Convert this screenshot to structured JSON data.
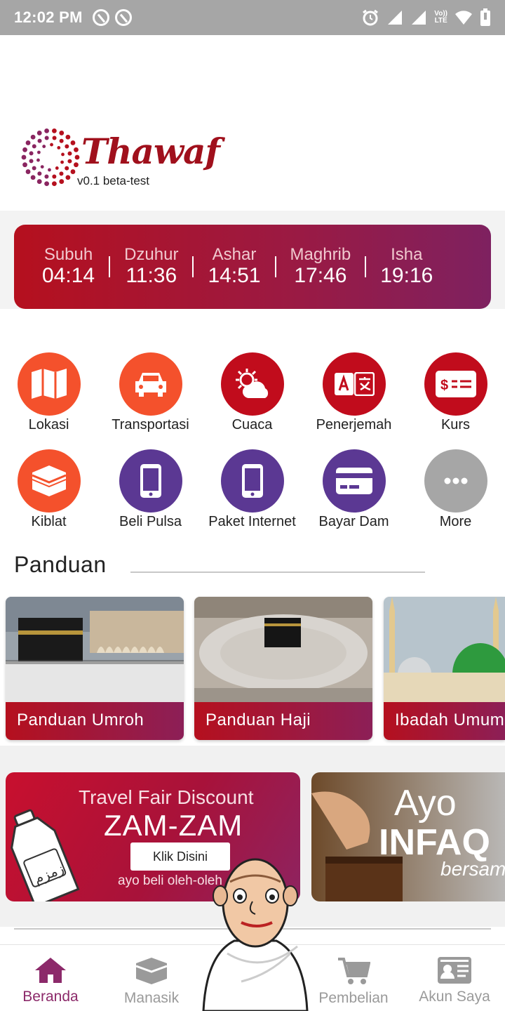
{
  "status_bar": {
    "time": "12:02 PM",
    "lte_top": "Vo))",
    "lte_bottom": "LTE"
  },
  "header": {
    "app_name": "Thawaf",
    "version": "v0.1 beta-test"
  },
  "prayer_times": [
    {
      "name": "Subuh",
      "time": "04:14"
    },
    {
      "name": "Dzuhur",
      "time": "11:36"
    },
    {
      "name": "Ashar",
      "time": "14:51"
    },
    {
      "name": "Maghrib",
      "time": "17:46"
    },
    {
      "name": "Isha",
      "time": "19:16"
    }
  ],
  "menu": [
    {
      "label": "Lokasi",
      "icon": "map-icon",
      "color": "#f4512c"
    },
    {
      "label": "Transportasi",
      "icon": "car-icon",
      "color": "#f4512c"
    },
    {
      "label": "Cuaca",
      "icon": "weather-icon",
      "color": "#c10c1c"
    },
    {
      "label": "Penerjemah",
      "icon": "translate-icon",
      "color": "#c10c1c"
    },
    {
      "label": "Kurs",
      "icon": "currency-icon",
      "color": "#c10c1c"
    },
    {
      "label": "Kiblat",
      "icon": "kaaba-icon",
      "color": "#f4512c"
    },
    {
      "label": "Beli Pulsa",
      "icon": "phone-icon",
      "color": "#5b3893"
    },
    {
      "label": "Paket Internet",
      "icon": "phone-icon",
      "color": "#5b3893"
    },
    {
      "label": "Bayar Dam",
      "icon": "card-icon",
      "color": "#5b3893"
    },
    {
      "label": "More",
      "icon": "more-icon",
      "color": "#a6a6a6"
    }
  ],
  "guide": {
    "title": "Panduan",
    "cards": [
      {
        "label": "Panduan Umroh"
      },
      {
        "label": "Panduan Haji"
      },
      {
        "label": "Ibadah Umum"
      }
    ]
  },
  "promos": {
    "zamzam": {
      "line1": "Travel Fair Discount",
      "line2": "ZAM-ZAM",
      "button": "Klik Disini",
      "line3": "ayo beli oleh-oleh",
      "bottle_text": "زمزم"
    },
    "infaq": {
      "line1": "Ayo",
      "line2": "INFAQ",
      "line3": "bersama"
    }
  },
  "bottom_nav": [
    {
      "label": "Beranda",
      "icon": "home-icon",
      "active": true
    },
    {
      "label": "Manasik",
      "icon": "kaaba-icon",
      "active": false
    },
    {
      "label": "Pembelian",
      "icon": "cart-icon",
      "active": false
    },
    {
      "label": "Akun Saya",
      "icon": "id-card-icon",
      "active": false
    }
  ],
  "colors": {
    "brand_red": "#c10c1c",
    "brand_orange": "#f4512c",
    "brand_purple": "#5b3893",
    "active_nav": "#8c2a6a"
  }
}
